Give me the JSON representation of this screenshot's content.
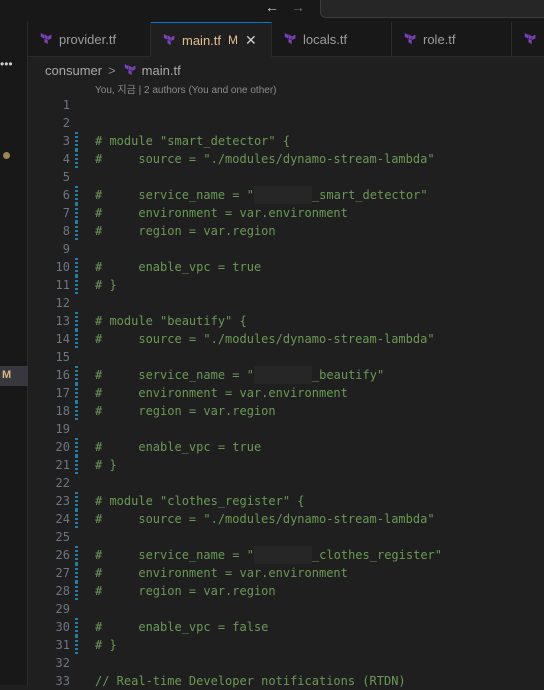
{
  "titlebar": {
    "back_icon": "arrow-left-icon",
    "forward_icon": "arrow-right-icon"
  },
  "sidebar": {
    "more_icon": "ellipsis-icon",
    "modified_badge": "M",
    "modified_dot_color": "#9b8750"
  },
  "tabs": [
    {
      "label": "provider.tf",
      "active": false
    },
    {
      "label": "main.tf",
      "active": true,
      "modified": "M",
      "close": "✕"
    },
    {
      "label": "locals.tf",
      "active": false
    },
    {
      "label": "role.tf",
      "active": false
    }
  ],
  "breadcrumb": {
    "folder": "consumer",
    "separator": ">",
    "file": "main.tf"
  },
  "blame": "You, 지금 | 2 authors (You and one other)",
  "editor": {
    "comment_color": "#6a9955",
    "lines": [
      {
        "num": "1",
        "text": "",
        "changed": false
      },
      {
        "num": "2",
        "text": "",
        "changed": false
      },
      {
        "num": "3",
        "text": "# module \"smart_detector\" {",
        "changed": true
      },
      {
        "num": "4",
        "text": "#     source = \"./modules/dynamo-stream-lambda\"",
        "changed": true
      },
      {
        "num": "5",
        "text": "",
        "changed": false
      },
      {
        "num": "6",
        "pre": "#     service_name = \"",
        "post": "_smart_detector\"",
        "redacted": true,
        "changed": true
      },
      {
        "num": "7",
        "text": "#     environment = var.environment",
        "changed": true
      },
      {
        "num": "8",
        "text": "#     region = var.region",
        "changed": true
      },
      {
        "num": "9",
        "text": "",
        "changed": false
      },
      {
        "num": "10",
        "text": "#     enable_vpc = true",
        "changed": true
      },
      {
        "num": "11",
        "text": "# }",
        "changed": true
      },
      {
        "num": "12",
        "text": "",
        "changed": false
      },
      {
        "num": "13",
        "text": "# module \"beautify\" {",
        "changed": true
      },
      {
        "num": "14",
        "text": "#     source = \"./modules/dynamo-stream-lambda\"",
        "changed": true
      },
      {
        "num": "15",
        "text": "",
        "changed": false
      },
      {
        "num": "16",
        "pre": "#     service_name = \"",
        "post": "_beautify\"",
        "redacted": true,
        "changed": true
      },
      {
        "num": "17",
        "text": "#     environment = var.environment",
        "changed": true
      },
      {
        "num": "18",
        "text": "#     region = var.region",
        "changed": true
      },
      {
        "num": "19",
        "text": "",
        "changed": false
      },
      {
        "num": "20",
        "text": "#     enable_vpc = true",
        "changed": true
      },
      {
        "num": "21",
        "text": "# }",
        "changed": true
      },
      {
        "num": "22",
        "text": "",
        "changed": false
      },
      {
        "num": "23",
        "text": "# module \"clothes_register\" {",
        "changed": true
      },
      {
        "num": "24",
        "text": "#     source = \"./modules/dynamo-stream-lambda\"",
        "changed": true
      },
      {
        "num": "25",
        "text": "",
        "changed": false
      },
      {
        "num": "26",
        "pre": "#     service_name = \"",
        "post": "_clothes_register\"",
        "redacted": true,
        "changed": true
      },
      {
        "num": "27",
        "text": "#     environment = var.environment",
        "changed": true
      },
      {
        "num": "28",
        "text": "#     region = var.region",
        "changed": true
      },
      {
        "num": "29",
        "text": "",
        "changed": false
      },
      {
        "num": "30",
        "text": "#     enable_vpc = false",
        "changed": true
      },
      {
        "num": "31",
        "text": "# }",
        "changed": true
      },
      {
        "num": "32",
        "text": "",
        "changed": false
      },
      {
        "num": "33",
        "text": "// Real-time Developer notifications (RTDN)",
        "changed": false
      }
    ]
  }
}
